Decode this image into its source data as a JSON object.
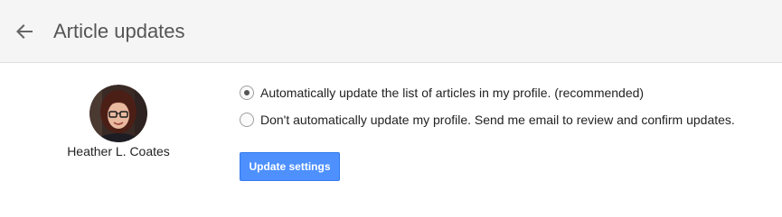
{
  "header": {
    "title": "Article updates",
    "back_icon": "arrow-back-icon"
  },
  "profile": {
    "name": "Heather L. Coates",
    "avatar_icon": "user-photo"
  },
  "options": [
    {
      "label": "Automatically update the list of articles in my profile. (recommended)",
      "selected": true
    },
    {
      "label": "Don't automatically update my profile. Send me email to review and confirm updates.",
      "selected": false
    }
  ],
  "actions": {
    "update_label": "Update settings"
  },
  "colors": {
    "header_bg": "#f5f5f5",
    "accent": "#4d90fe",
    "accent_border": "#3079ed",
    "title_text": "#555555"
  }
}
